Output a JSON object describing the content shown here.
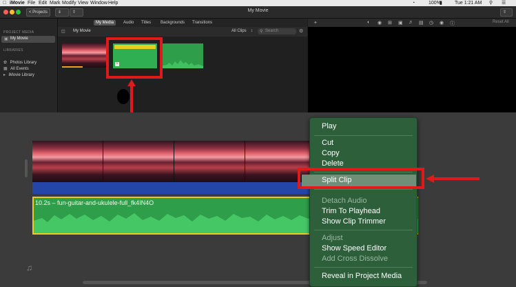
{
  "menubar": {
    "app": "iMovie",
    "items": [
      "File",
      "Edit",
      "Mark",
      "Modify",
      "View",
      "Window",
      "Help"
    ],
    "window_title": "My Movie",
    "battery": "100%",
    "clock": "Tue 1:21 AM"
  },
  "toolbar": {
    "projects_label": "< Projects",
    "title": "My Movie"
  },
  "tabs": [
    "My Media",
    "Audio",
    "Titles",
    "Backgrounds",
    "Transitions"
  ],
  "sidebar": {
    "project_media_heading": "PROJECT MEDIA",
    "project_item": "My Movie",
    "libraries_heading": "LIBRARIES",
    "library_items": [
      "Photos Library",
      "All Events",
      "iMovie Library"
    ]
  },
  "browser": {
    "title": "My Movie",
    "filter": "All Clips",
    "search_placeholder": "Search"
  },
  "viewer": {
    "reset_all": "Reset All"
  },
  "timeline": {
    "audio_clip_label": "10.2s – fun-guitar-and-ukulele-full_fk4IN4O"
  },
  "context_menu": {
    "items": [
      {
        "label": "Play",
        "enabled": true
      },
      {
        "label": "Cut",
        "enabled": true
      },
      {
        "label": "Copy",
        "enabled": true
      },
      {
        "label": "Delete",
        "enabled": true
      },
      {
        "label": "Split Clip",
        "enabled": true,
        "highlighted": true
      },
      {
        "label": "Detach Audio",
        "enabled": false
      },
      {
        "label": "Trim To Playhead",
        "enabled": true
      },
      {
        "label": "Show Clip Trimmer",
        "enabled": true
      },
      {
        "label": "Adjust",
        "enabled": false
      },
      {
        "label": "Show Speed Editor",
        "enabled": true
      },
      {
        "label": "Add Cross Dissolve",
        "enabled": false
      },
      {
        "label": "Reveal in Project Media",
        "enabled": true
      }
    ]
  },
  "colors": {
    "highlight_red": "#e01a1a",
    "menu_green": "#2c5f3a",
    "audio_green": "#2f9e4a",
    "video_blue": "#2346a8"
  }
}
